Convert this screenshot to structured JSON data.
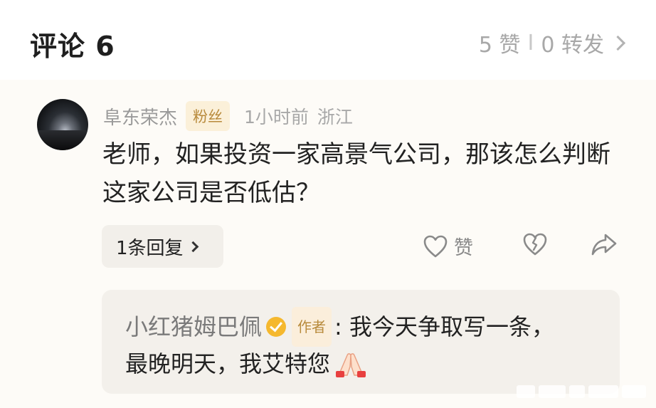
{
  "header": {
    "title": "评论 6",
    "likes": "5 赞",
    "separator": "I",
    "reposts": "0 转发"
  },
  "comment": {
    "username": "阜东荣杰",
    "fan_badge": "粉丝",
    "time": "1小时前",
    "location": "浙江",
    "text": "老师，如果投资一家高景气公司，那该怎么判断这家公司是否低估？",
    "replies_label": "1条回复",
    "like_label": "赞"
  },
  "reply": {
    "author": "小红猪姆巴佩",
    "author_badge": "作者",
    "text_line1": ": 我今天争取写一条，",
    "text_line2": "最晚明天，我艾特您"
  },
  "icons": {
    "avatar": "night-sky-avatar",
    "like": "heart-outline-icon",
    "dislike": "broken-heart-icon",
    "share": "share-arrow-icon",
    "verified": "verified-badge-icon",
    "emoji": "folded-hands-emoji"
  },
  "colors": {
    "badge_gold": "#b88a3b",
    "verified_yellow": "#f5b82e",
    "muted_text": "#a8a8a8"
  }
}
